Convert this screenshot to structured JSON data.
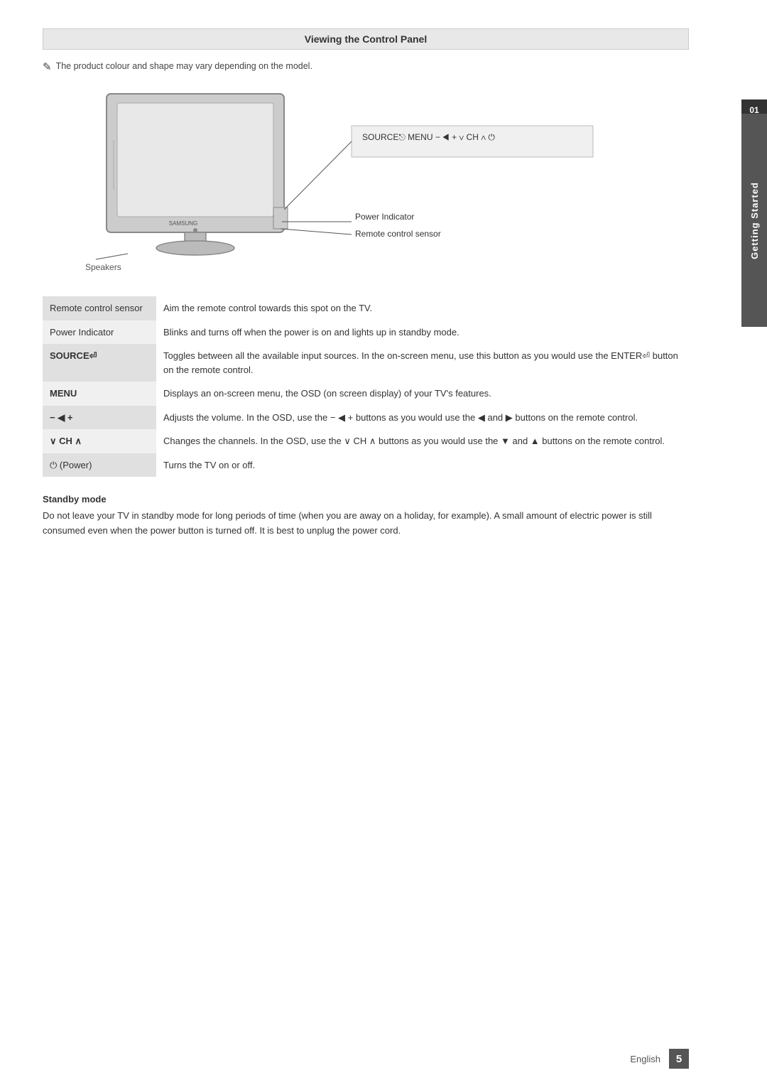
{
  "page": {
    "title": "Viewing the Control Panel",
    "note": "The product colour and shape may vary depending on the model.",
    "note_icon": "✎",
    "side_tab": {
      "number": "01",
      "label": "Getting Started"
    },
    "footer": {
      "lang": "English",
      "page_number": "5"
    }
  },
  "control_panel_label": "SOURCE⏎ MENU  −  ◀ +   ∨ CH ∧   ⏻",
  "labels": {
    "power_indicator": "Power Indicator",
    "remote_control_sensor": "Remote control sensor",
    "speakers": "Speakers"
  },
  "table": {
    "rows": [
      {
        "label": "Remote control sensor",
        "description": "Aim the remote control towards this spot on the TV.",
        "bold": false
      },
      {
        "label": "Power Indicator",
        "description": "Blinks and turns off when the power is on and lights up in standby mode.",
        "bold": false
      },
      {
        "label": "SOURCE⏎",
        "description": "Toggles between all the available input sources. In the on-screen menu, use this button as you would use the ENTER⏎ button on the remote control.",
        "bold": true
      },
      {
        "label": "MENU",
        "description": "Displays an on-screen menu, the OSD (on screen display) of your TV's features.",
        "bold": true
      },
      {
        "label": "− ◀ +",
        "description": "Adjusts the volume. In the OSD, use the − ◀ + buttons as you would use the ◀ and ▶ buttons on the remote control.",
        "bold": true
      },
      {
        "label": "∨ CH ∧",
        "description": "Changes the channels. In the OSD, use the ∨ CH ∧ buttons as you would use the ▼ and ▲ buttons on the remote control.",
        "bold": true
      },
      {
        "label": "⏻ (Power)",
        "description": "Turns the TV on or off.",
        "bold": false
      }
    ]
  },
  "standby": {
    "title": "Standby mode",
    "text": "Do not leave your TV in standby mode for long periods of time (when you are away on a holiday, for example). A small amount of electric power is still consumed even when the power button is turned off. It is best to unplug the power cord."
  }
}
